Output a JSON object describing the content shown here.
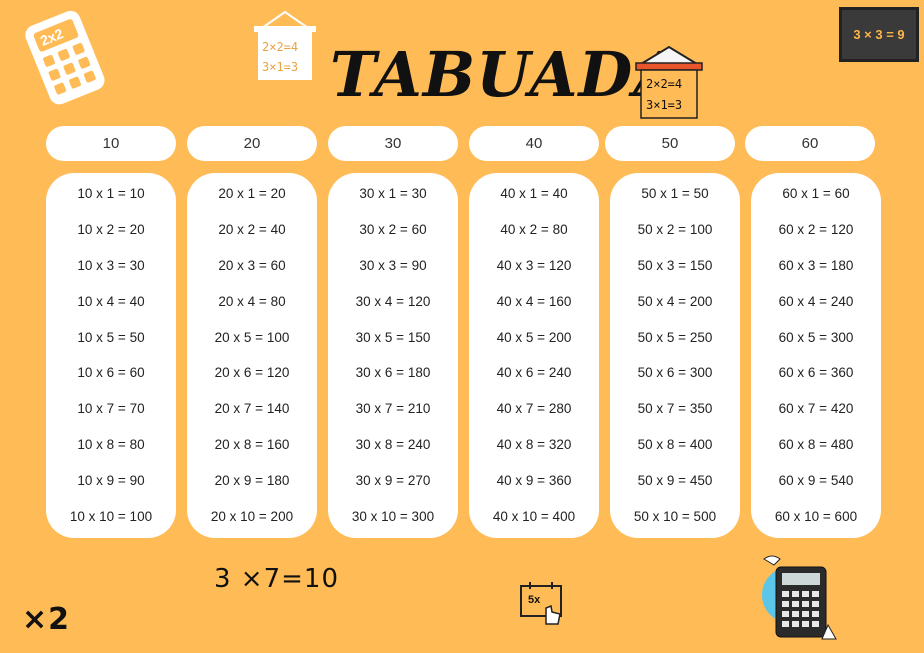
{
  "title": "TABUADA",
  "decorations": {
    "sign_left_line1": "2×2=4",
    "sign_left_line2": "3×1=3",
    "sign_right_line1": "2×2=4",
    "sign_right_line2": "3×1=3",
    "badge_text": "3 × 3 = 9",
    "calculator_screen": "2x2",
    "handwritten_equation": "3 ×7=10",
    "times_two": "×2",
    "calendar_text": "5x"
  },
  "columns": [
    {
      "header": "10",
      "rows": [
        "10 x 1 = 10",
        "10 x 2 = 20",
        "10 x 3 = 30",
        "10 x 4 = 40",
        "10 x 5 = 50",
        "10 x 6 = 60",
        "10 x 7 = 70",
        "10 x 8 = 80",
        "10 x 9 = 90",
        "10 x 10 = 100"
      ]
    },
    {
      "header": "20",
      "rows": [
        "20 x 1 = 20",
        "20 x 2 = 40",
        "20 x 3 = 60",
        "20 x 4 = 80",
        "20 x 5 = 100",
        "20 x 6 = 120",
        "20 x 7 = 140",
        "20 x 8 = 160",
        "20 x 9 = 180",
        "20 x 10 = 200"
      ]
    },
    {
      "header": "30",
      "rows": [
        "30 x 1 = 30",
        "30 x 2 = 60",
        "30 x 3 = 90",
        "30 x 4 = 120",
        "30 x 5 = 150",
        "30 x 6 = 180",
        "30 x 7 = 210",
        "30 x 8 = 240",
        "30 x 9 = 270",
        "30 x 10 = 300"
      ]
    },
    {
      "header": "40",
      "rows": [
        "40 x 1 = 40",
        "40 x 2 = 80",
        "40 x 3 = 120",
        "40 x 4 = 160",
        "40 x 5 = 200",
        "40 x 6 = 240",
        "40 x 7 = 280",
        "40 x 8 = 320",
        "40 x 9 = 360",
        "40 x 10 = 400"
      ]
    },
    {
      "header": "50",
      "rows": [
        "50 x 1 = 50",
        "50 x 2 = 100",
        "50 x 3 = 150",
        "50 x 4 = 200",
        "50 x 5 = 250",
        "50 x 6 = 300",
        "50 x 7 = 350",
        "50 x 8 = 400",
        "50 x 9 = 450",
        "50 x 10 = 500"
      ]
    },
    {
      "header": "60",
      "rows": [
        "60 x 1 = 60",
        "60 x 2 = 120",
        "60 x 3 = 180",
        "60 x 4 = 240",
        "60 x 5 = 300",
        "60 x 6 = 360",
        "60 x 7 = 420",
        "60 x 8 = 480",
        "60 x 9 = 540",
        "60 x 10 = 600"
      ]
    }
  ]
}
